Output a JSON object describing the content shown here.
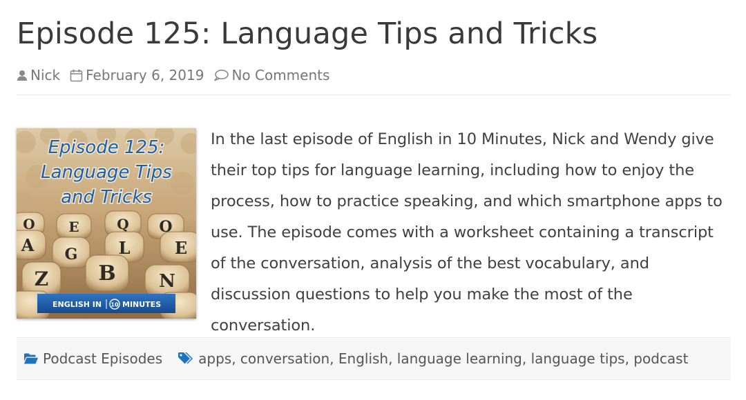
{
  "post": {
    "title": "Episode 125: Language Tips and Tricks",
    "meta": {
      "author": "Nick",
      "date": "February 6, 2019",
      "comments": "No Comments"
    },
    "thumbnail": {
      "line1": "Episode 125:",
      "line2": "Language Tips",
      "line3": "and Tricks",
      "brand_left": "ENGLISH IN",
      "brand_num": "10",
      "brand_right": "MINUTES",
      "tile_letters": [
        "O",
        "E",
        "Q",
        "O",
        "A",
        "G",
        "L",
        "E",
        "Z",
        "B",
        "N"
      ]
    },
    "body": "In the last episode of English in 10 Minutes, Nick and Wendy give their top tips for language learning, including how to enjoy the process, how to practice speaking, and which smartphone apps to use. The episode comes with a worksheet containing a transcript of the conversation, analysis of the best vocabulary, and discussion questions to help you make the most of the conversation.",
    "footer": {
      "category": "Podcast Episodes",
      "tags": "apps, conversation, English, language learning, language tips, podcast"
    }
  },
  "colors": {
    "accent_blue": "#1e73be",
    "title_text": "#3a3a3a",
    "meta_text": "#777777",
    "thumb_title": "#1d5fa8",
    "brand_bar": "#1f5ea8"
  }
}
